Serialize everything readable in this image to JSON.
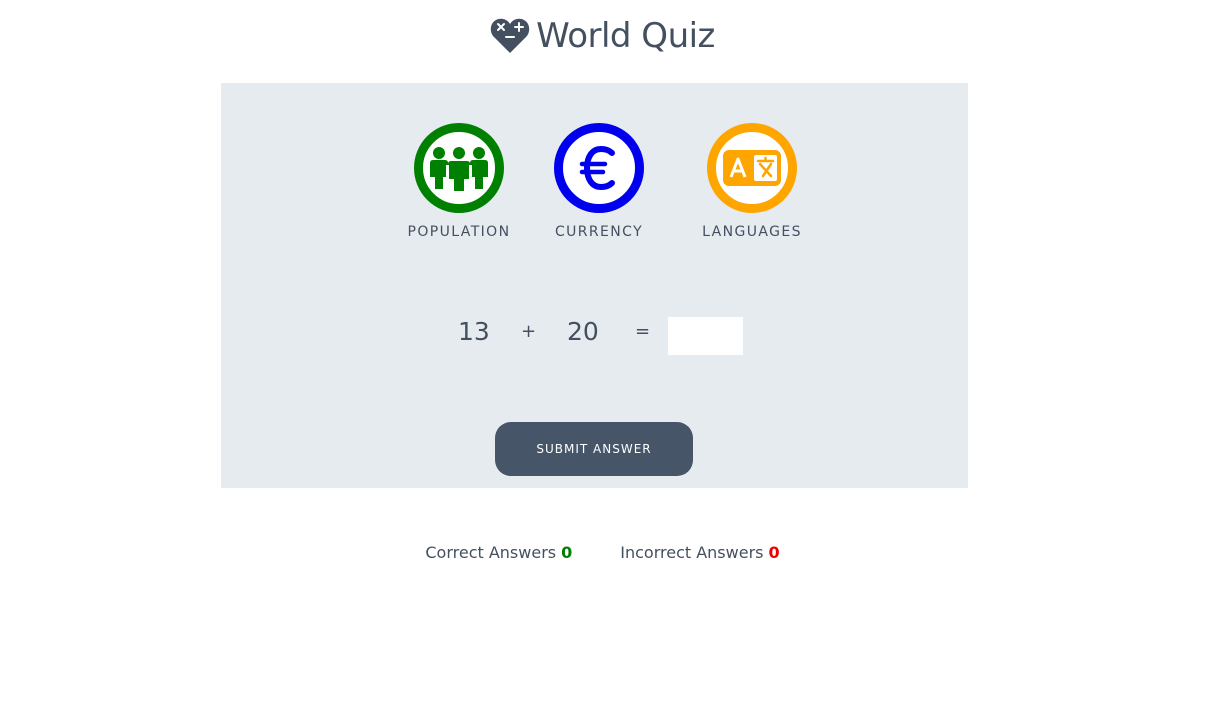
{
  "app": {
    "title": "World Quiz"
  },
  "categories": [
    {
      "label": "POPULATION",
      "icon": "population-icon",
      "color": "#008000"
    },
    {
      "label": "CURRENCY",
      "icon": "euro-currency-icon",
      "color": "#0000ee"
    },
    {
      "label": "LANGUAGES",
      "icon": "translate-icon",
      "color": "#ffa500"
    }
  ],
  "quiz": {
    "operand_a": "13",
    "operator": "+",
    "operand_b": "20",
    "equals": "=",
    "answer_value": "",
    "submit_label": "SUBMIT ANSWER"
  },
  "scores": {
    "correct_label": "Correct Answers",
    "correct_value": "0",
    "correct_color": "#008000",
    "incorrect_label": "Incorrect Answers",
    "incorrect_value": "0",
    "incorrect_color": "#ee0000"
  },
  "colors": {
    "panel_bg": "#e6ebf0",
    "button_bg": "#475569",
    "text": "#44505f"
  }
}
